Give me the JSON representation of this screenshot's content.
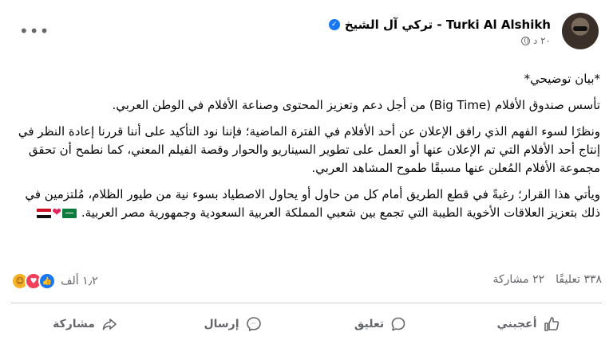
{
  "header": {
    "author_name": "Turki Al Alshikh - تركي آل الشيخ",
    "verified_symbol": "✓",
    "time": "٢٠ د",
    "more_label": "•••"
  },
  "content": {
    "title": "*بيان توضيحي*",
    "p1": "تأسس صندوق الأفلام (Big Time) من أجل دعم وتعزيز المحتوى وصناعة الأفلام في الوطن العربي.",
    "p2": "ونظرًا لسوء الفهم الذي رافق الإعلان عن أحد الأفلام في الفترة الماضية؛ فإننا نود التأكيد على أننا قررنا إعادة النظر في إنتاج أحد الأفلام التي تم الإعلان عنها أو العمل على تطوير السيناريو والحوار وقصة الفيلم المعني، كما نطمح أن تحقق مجموعة الأفلام المُعلن عنها مسبقًا طموح المشاهد العربي.",
    "p3": "ويأتي هذا القرار؛ رغبةً في قطع الطريق أمام كل من حاول أو يحاول الاصطياد بسوء نية من طيور الظلام، مُلتزمين في ذلك بتعزيز العلاقات الأخوية الطيبة التي تجمع بين شعبي المملكة العربية السعودية وجمهورية مصر العربية."
  },
  "stats": {
    "reactions_count": "١٫٢ ألف",
    "comments": "٣٣٨ تعليقًا",
    "shares": "٢٢ مشاركة"
  },
  "actions": {
    "like": "أعجبني",
    "comment": "تعليق",
    "send": "إرسال",
    "share": "مشاركة"
  }
}
